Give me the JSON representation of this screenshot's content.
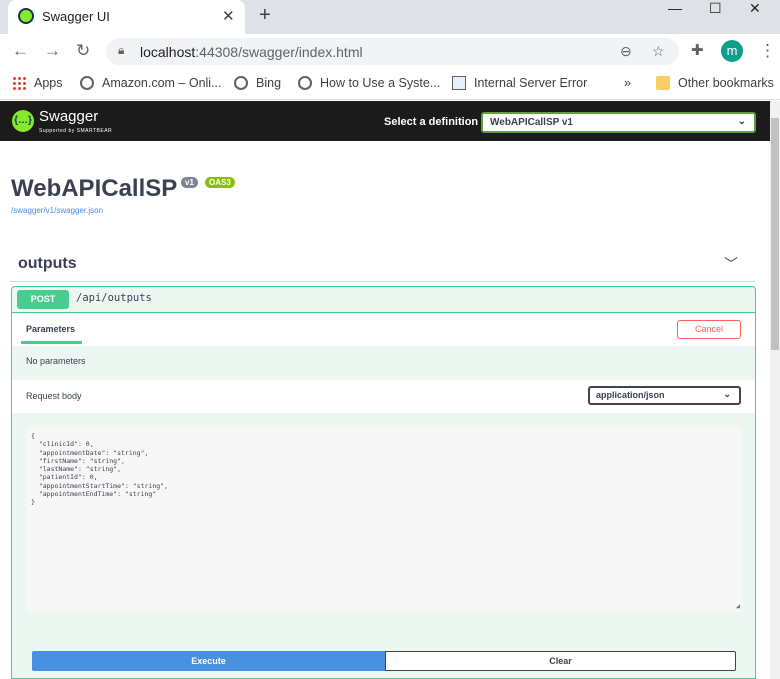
{
  "browser": {
    "tab_title": "Swagger UI",
    "tab_close": "✕",
    "new_tab": "+",
    "win_minimize": "—",
    "win_maximize": "☐",
    "win_close": "✕",
    "url_host": "localhost",
    "url_rest": ":44308/swagger/index.html",
    "profile_initial": "m",
    "bookmarks": [
      "Apps",
      "Amazon.com – Onli...",
      "Bing",
      "How to Use a Syste...",
      "Internal Server Error"
    ],
    "bookmarks_overflow": "»",
    "other_bookmarks": "Other bookmarks"
  },
  "topbar": {
    "logo_text": "Swagger",
    "logo_sub": "Supported by SMARTBEAR",
    "definition_label": "Select a definition",
    "definition_value": "WebAPICallSP v1"
  },
  "info": {
    "title": "WebAPICallSP",
    "version": "v1",
    "oas": "OAS3",
    "spec_url": "/swagger/v1/swagger.json"
  },
  "tag": {
    "name": "outputs",
    "operation": {
      "method": "POST",
      "path": "/api/outputs",
      "params_tab": "Parameters",
      "cancel_label": "Cancel",
      "no_params": "No parameters",
      "request_body_label": "Request body",
      "content_type": "application/json",
      "body_text": "{\n  \"clinicId\": 0,\n  \"appointmentDate\": \"string\",\n  \"firstName\": \"string\",\n  \"lastName\": \"string\",\n  \"patientId\": 0,\n  \"appointmentStartTime\": \"string\",\n  \"appointmentEndTime\": \"string\"\n}",
      "execute_label": "Execute",
      "clear_label": "Clear"
    }
  },
  "colors": {
    "post_green": "#49cc90",
    "execute_blue": "#4990e2",
    "cancel_red": "#ff6060",
    "topbar_bg": "#1b1b1b"
  }
}
